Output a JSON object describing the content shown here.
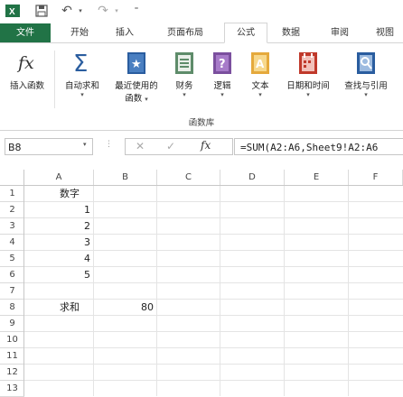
{
  "quick_access": {
    "undo_label": "↶",
    "redo_label": "↷"
  },
  "tabs": [
    "文件",
    "开始",
    "插入",
    "页面布局",
    "公式",
    "数据",
    "审阅",
    "视图"
  ],
  "active_tab": "公式",
  "ribbon": {
    "buttons": [
      {
        "label": "插入函数",
        "icon": "fx-icon"
      },
      {
        "label": "自动求和",
        "icon": "sigma-icon",
        "caret": "▾"
      },
      {
        "label": "最近使用的",
        "label2": "函数",
        "icon": "star-book-icon",
        "caret": "▾"
      },
      {
        "label": "财务",
        "icon": "finance-book-icon",
        "caret": "▾"
      },
      {
        "label": "逻辑",
        "icon": "logic-book-icon",
        "caret": "▾"
      },
      {
        "label": "文本",
        "icon": "text-book-icon",
        "caret": "▾"
      },
      {
        "label": "日期和时间",
        "icon": "calendar-book-icon",
        "caret": "▾"
      },
      {
        "label": "查找与引用",
        "icon": "lookup-book-icon",
        "caret": "▾"
      }
    ],
    "group_label": "函数库"
  },
  "formula_bar": {
    "name_box": "B8",
    "fx_label": "fx",
    "formula": "=SUM(A2:A6,Sheet9!A2:A6"
  },
  "columns": [
    "A",
    "B",
    "C",
    "D",
    "E",
    "F"
  ],
  "rows": [
    "1",
    "2",
    "3",
    "4",
    "5",
    "6",
    "7",
    "8",
    "9",
    "10",
    "11",
    "12",
    "13"
  ],
  "cells": {
    "A1": "数字",
    "A2": "1",
    "A3": "2",
    "A4": "3",
    "A5": "4",
    "A6": "5",
    "A8": "求和",
    "B8": "80"
  },
  "colors": {
    "excel_green": "#217346",
    "accent_blue": "#2a5d9f"
  }
}
